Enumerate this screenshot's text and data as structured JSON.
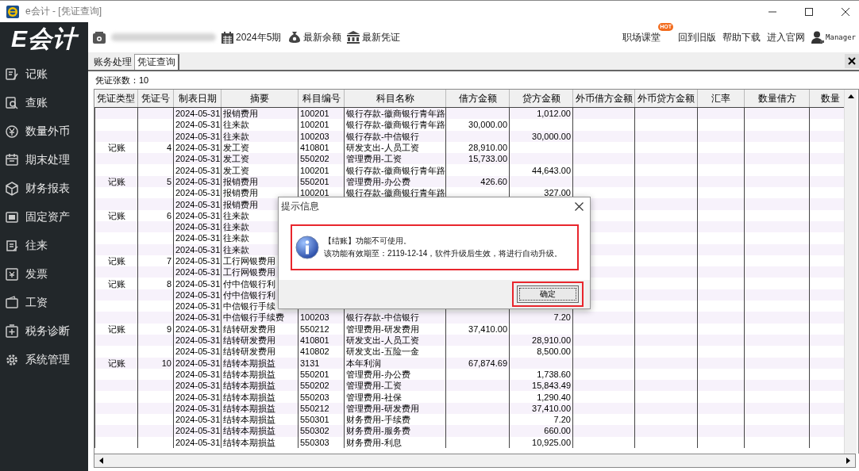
{
  "window": {
    "title": "e会计 - [凭证查询]"
  },
  "sidebar": {
    "logo": "E会计",
    "items": [
      {
        "label": "记账"
      },
      {
        "label": "查账"
      },
      {
        "label": "数量外币"
      },
      {
        "label": "期末处理"
      },
      {
        "label": "财务报表"
      },
      {
        "label": "固定资产"
      },
      {
        "label": "往来"
      },
      {
        "label": "发票"
      },
      {
        "label": "工资"
      },
      {
        "label": "税务诊断"
      },
      {
        "label": "系统管理"
      }
    ]
  },
  "toolbar": {
    "period": "2024年5期",
    "buttons": [
      "最新余额",
      "最新凭证"
    ],
    "links": [
      {
        "label": "职场课堂",
        "badge": "HOT"
      },
      {
        "label": "回到旧版"
      },
      {
        "label": "帮助下载"
      },
      {
        "label": "进入官网"
      }
    ],
    "user": "Manager"
  },
  "tabs": [
    {
      "label": "账务处理",
      "selected": false
    },
    {
      "label": "凭证查询",
      "selected": true
    }
  ],
  "voucher_count": "凭证张数：10",
  "table": {
    "columns": [
      "凭证类型",
      "凭证号",
      "制表日期",
      "摘要",
      "科目编号",
      "科目名称",
      "借方金额",
      "贷方金额",
      "外币借方金额",
      "外币贷方金额",
      "汇率",
      "数量借方",
      "数量"
    ],
    "rows": [
      {
        "date": "2024-05-31",
        "summary": "报销费用",
        "code": "100201",
        "account": "银行存款-徽商银行青年路",
        "credit": "1,012.00"
      },
      {
        "date": "2024-05-31",
        "summary": "往来款",
        "code": "100201",
        "account": "银行存款-徽商银行青年路",
        "debit": "30,000.00"
      },
      {
        "date": "2024-05-31",
        "summary": "往来款",
        "code": "100203",
        "account": "银行存款-中信银行",
        "credit": "30,000.00"
      },
      {
        "type": "记账",
        "no": "4",
        "date": "2024-05-31",
        "summary": "发工资",
        "code": "410801",
        "account": "研发支出-人员工资",
        "debit": "28,910.00"
      },
      {
        "date": "2024-05-31",
        "summary": "发工资",
        "code": "550202",
        "account": "管理费用-工资",
        "debit": "15,733.00"
      },
      {
        "date": "2024-05-31",
        "summary": "发工资",
        "code": "100201",
        "account": "银行存款-徽商银行青年路",
        "credit": "44,643.00"
      },
      {
        "type": "记账",
        "no": "5",
        "date": "2024-05-31",
        "summary": "报销费用",
        "code": "550201",
        "account": "管理费用-办公费",
        "debit": "426.60"
      },
      {
        "date": "2024-05-31",
        "summary": "报销费用",
        "code": "100201",
        "account": "银行存款-徽商银行青年路",
        "credit": "327.00"
      },
      {
        "date": "2024-05-31",
        "summary": "报销费用"
      },
      {
        "type": "记账",
        "no": "6",
        "date": "2024-05-31",
        "summary": "往来款"
      },
      {
        "date": "2024-05-31",
        "summary": "往来款"
      },
      {
        "date": "2024-05-31",
        "summary": "往来款"
      },
      {
        "date": "2024-05-31",
        "summary": "往来款"
      },
      {
        "type": "记账",
        "no": "7",
        "date": "2024-05-31",
        "summary": "工行网银费用"
      },
      {
        "date": "2024-05-31",
        "summary": "工行网银费用"
      },
      {
        "type": "记账",
        "no": "8",
        "date": "2024-05-31",
        "summary": "付中信银行利"
      },
      {
        "date": "2024-05-31",
        "summary": "付中信银行利"
      },
      {
        "date": "2024-05-31",
        "summary": "中信银行手续"
      },
      {
        "date": "2024-05-31",
        "summary": "中信银行手续费",
        "code": "100203",
        "account": "银行存款-中信银行",
        "credit": "7.20"
      },
      {
        "type": "记账",
        "no": "9",
        "date": "2024-05-31",
        "summary": "结转研发费用",
        "code": "550212",
        "account": "管理费用-研发费用",
        "debit": "37,410.00"
      },
      {
        "date": "2024-05-31",
        "summary": "结转研发费用",
        "code": "410801",
        "account": "研发支出-人员工资",
        "credit": "28,910.00"
      },
      {
        "date": "2024-05-31",
        "summary": "结转研发费用",
        "code": "410802",
        "account": "研发支出-五险一金",
        "credit": "8,500.00"
      },
      {
        "type": "记账",
        "no": "10",
        "date": "2024-05-31",
        "summary": "结转本期损益",
        "code": "3131",
        "account": "本年利润",
        "debit": "67,874.69"
      },
      {
        "date": "2024-05-31",
        "summary": "结转本期损益",
        "code": "550201",
        "account": "管理费用-办公费",
        "credit": "1,738.60"
      },
      {
        "date": "2024-05-31",
        "summary": "结转本期损益",
        "code": "550202",
        "account": "管理费用-工资",
        "credit": "15,843.49"
      },
      {
        "date": "2024-05-31",
        "summary": "结转本期损益",
        "code": "550203",
        "account": "管理费用-社保",
        "credit": "1,290.40"
      },
      {
        "date": "2024-05-31",
        "summary": "结转本期损益",
        "code": "550212",
        "account": "管理费用-研发费用",
        "credit": "37,410.00"
      },
      {
        "date": "2024-05-31",
        "summary": "结转本期损益",
        "code": "550301",
        "account": "财务费用-手续费",
        "credit": "7.20"
      },
      {
        "date": "2024-05-31",
        "summary": "结转本期损益",
        "code": "550302",
        "account": "财务费用-服务费",
        "credit": "660.00"
      },
      {
        "date": "2024-05-31",
        "summary": "结转本期损益",
        "code": "550303",
        "account": "财务费用-利息",
        "credit": "10,925.00"
      }
    ]
  },
  "dialog": {
    "title": "提示信息",
    "lines": [
      "【结账】功能不可使用。",
      "该功能有效期至：2119-12-14，软件升级后生效，将进行自动升级。"
    ],
    "button": "确定"
  }
}
